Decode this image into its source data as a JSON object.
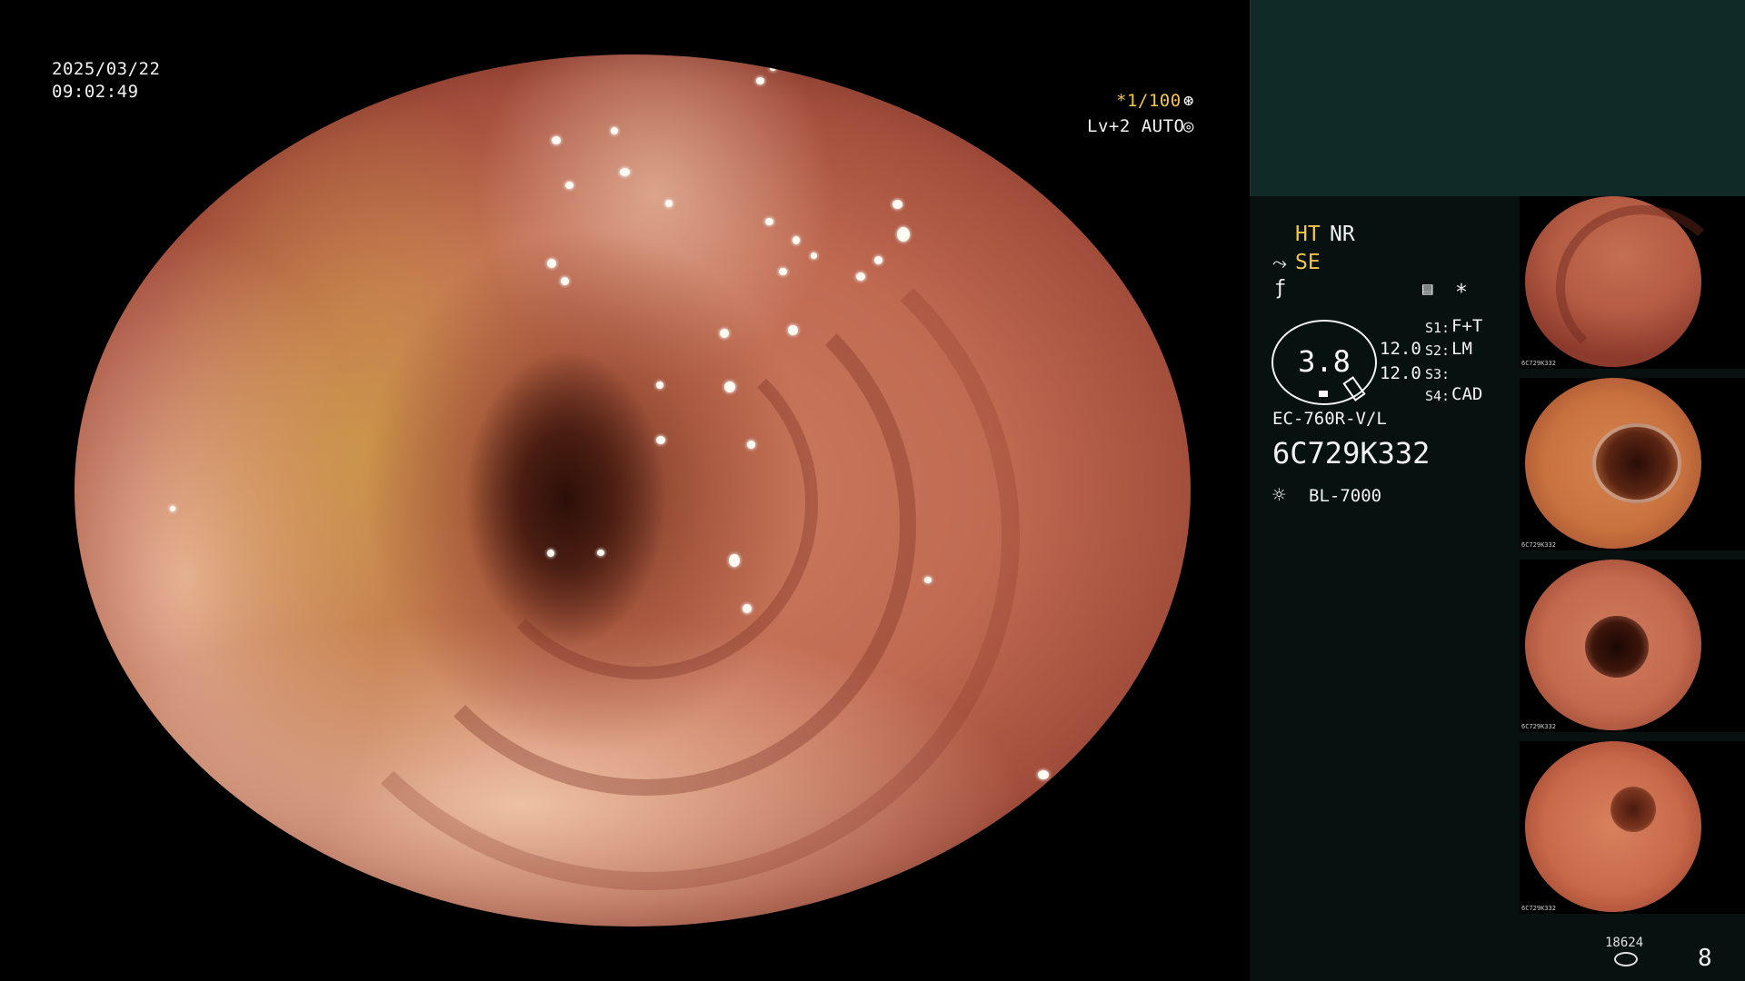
{
  "scope": {
    "date": "2025/03/22",
    "time": "09:02:49",
    "shutter": "*1/100",
    "shutter_icon": "aperture-icon",
    "level": "Lv+2 AUTO",
    "level_icon": "auto-exposure-icon"
  },
  "panel": {
    "mode_ht": "HT",
    "mode_nr": "NR",
    "mode_se_icon": "scope-tip-icon",
    "mode_se": "SE",
    "func_icon": "function-curve-icon",
    "settings_icon": "menu-list-icon",
    "star": "*",
    "gauge_value": "3.8",
    "gauge_side_1": "12.0",
    "gauge_side_2": "12.0",
    "s1_label": "S1:",
    "s1_value": "F+T",
    "s2_label": "S2:",
    "s2_value": "LM",
    "s3_label": "S3:",
    "s3_value": "",
    "s4_label": "S4:",
    "s4_value": "CAD",
    "scope_model": "EC-760R-V/L",
    "serial": "6C729K332",
    "light_icon": "light-source-icon",
    "light_source": "BL-7000",
    "counter_label": "18624",
    "counter_icon": "storage-icon",
    "page_number": "8"
  },
  "thumbnails": [
    {
      "caption": "6C729K332"
    },
    {
      "caption": "6C729K332"
    },
    {
      "caption": "6C729K332"
    },
    {
      "caption": "6C729K332"
    }
  ],
  "colors": {
    "accent_yellow": "#f1c64a",
    "panel_header": "#102b27",
    "panel_bg": "#07110f"
  }
}
